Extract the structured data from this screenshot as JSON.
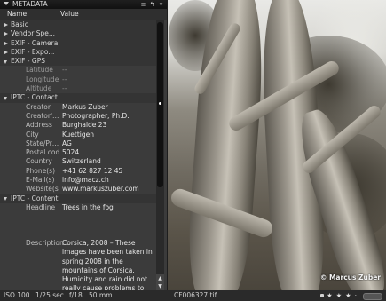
{
  "panel": {
    "title": "METADATA",
    "columns": {
      "name": "Name",
      "value": "Value"
    },
    "icons": [
      "menu-icon",
      "arrow-icon",
      "chevron-down-icon"
    ]
  },
  "groups": {
    "basic": "Basic",
    "vendor": "Vendor Spe...",
    "exif_camera": "EXIF - Camera",
    "exif_exposure": "EXIF - Expo...",
    "exif_gps": "EXIF - GPS",
    "iptc_contact": "IPTC - Contact",
    "iptc_content": "IPTC - Content"
  },
  "gps": {
    "latitude": {
      "key": "Latitude",
      "value": "--"
    },
    "longitude": {
      "key": "Longitude",
      "value": "--"
    },
    "altitude": {
      "key": "Altitude",
      "value": "--"
    }
  },
  "contact": {
    "creator": {
      "key": "Creator",
      "value": "Markus Zuber"
    },
    "creator_title": {
      "key": "Creator's...",
      "value": "Photographer, Ph.D."
    },
    "address": {
      "key": "Address",
      "value": "Burghalde 23"
    },
    "city": {
      "key": "City",
      "value": "Kuettigen"
    },
    "state": {
      "key": "State/Pro...",
      "value": "AG"
    },
    "postal": {
      "key": "Postal code",
      "value": "5024"
    },
    "country": {
      "key": "Country",
      "value": "Switzerland"
    },
    "phone": {
      "key": "Phone(s)",
      "value": "+41 62 827 12 45"
    },
    "email": {
      "key": "E-Mail(s)",
      "value": "info@macz.ch"
    },
    "website": {
      "key": "Website(s)",
      "value": "www.markuszuber.com"
    }
  },
  "content": {
    "headline": {
      "key": "Headline",
      "value": "Trees in the fog"
    },
    "description": {
      "key": "Description",
      "value": "Corsica, 2008 – These images have been taken in spring 2008 in the mountains of Corsica. Humidity and rain did not really cause problems to my equipment. So I could profit from the mystic"
    }
  },
  "photo": {
    "watermark": "© Marcus Zuber"
  },
  "status": {
    "iso": "ISO 100",
    "shutter": "1/25 sec",
    "aperture": "f/18",
    "focal": "50 mm",
    "filename": "CF006327.tif",
    "stars": "★ ★ ★ ·"
  }
}
